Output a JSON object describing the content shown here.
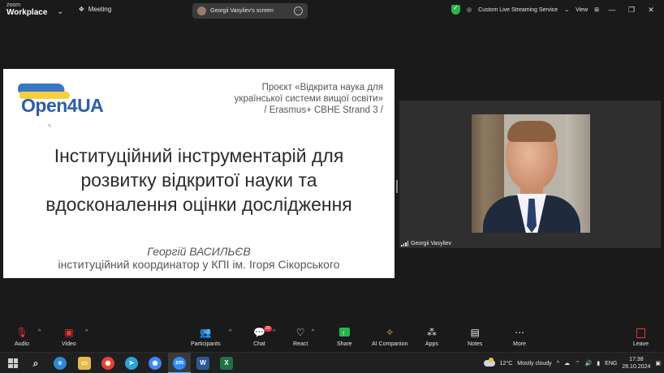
{
  "topbar": {
    "brand_top": "zoom",
    "brand_bottom": "Workplace",
    "meeting_label": "Meeting",
    "screen_share_label": "Georgii Vasyliev's screen",
    "live_streaming_label": "Custom Live Streaming Service",
    "view_label": "View"
  },
  "slide": {
    "logo_text": "Open4UA",
    "project_lines": [
      "Проєкт «Відкрита наука для",
      "української системи вищої освіти»",
      "/ Erasmus+ CBHE Strand 3 /"
    ],
    "title_lines": [
      "Інституційний інструментарій для",
      "розвитку відкритої науки та",
      "вдосконалення оцінки дослідження"
    ],
    "author_name": "Георгій ВАСИЛЬЄВ",
    "author_role": "інституційний координатор у КПІ ім. Ігоря Сікорського"
  },
  "video": {
    "participant_name": "Georgii Vasyliev"
  },
  "toolbar": {
    "audio": "Audio",
    "video": "Video",
    "participants": "Participants",
    "participants_count": "92",
    "chat": "Chat",
    "chat_badge": "29",
    "react": "React",
    "share": "Share",
    "ai_companion": "AI Companion",
    "apps": "Apps",
    "notes": "Notes",
    "more": "More",
    "leave": "Leave"
  },
  "taskbar": {
    "temperature": "12°C",
    "weather": "Mostly cloudy",
    "language": "ENG",
    "time": "17:38",
    "date": "28.10.2024"
  },
  "colors": {
    "accent_share": "#22b84a",
    "leave_red": "#e33333",
    "logo_blue": "#2d5ea8",
    "logo_yellow": "#f4d03f"
  }
}
